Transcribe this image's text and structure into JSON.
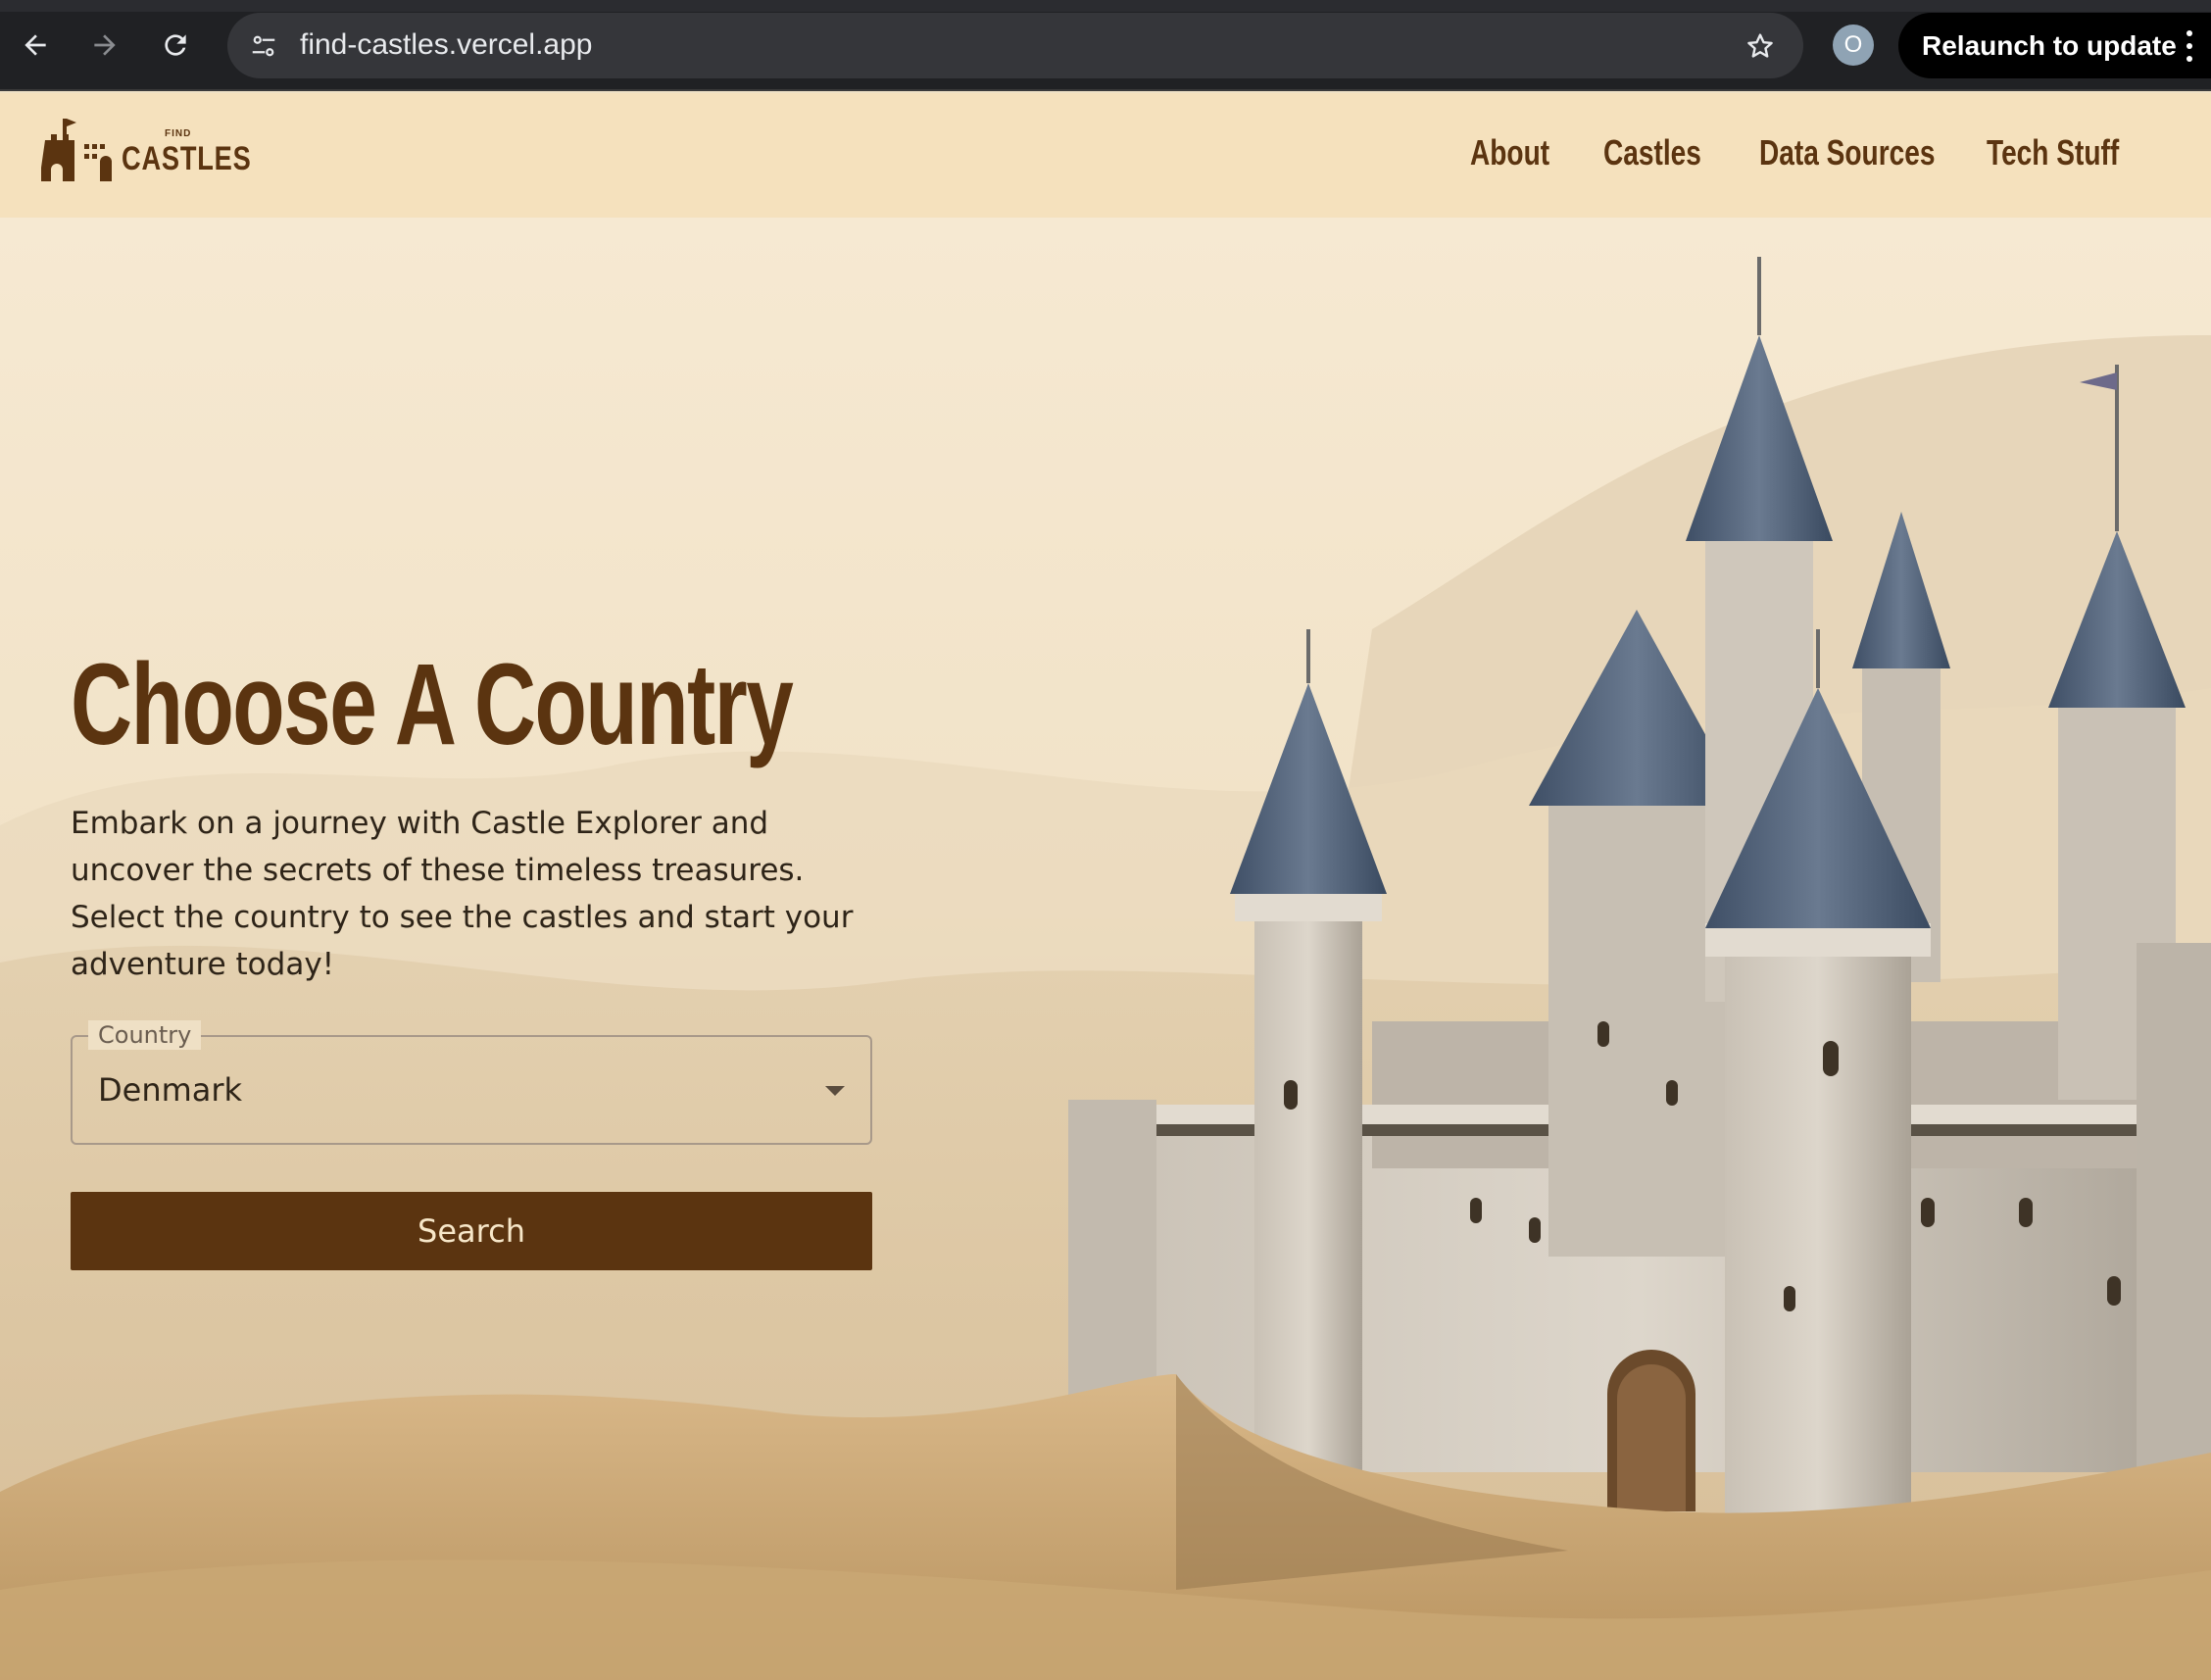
{
  "browser": {
    "url": "find-castles.vercel.app",
    "profile_initial": "O",
    "relaunch_label": "Relaunch to update",
    "icons": [
      "back-arrow-icon",
      "forward-arrow-icon",
      "reload-icon",
      "site-settings-icon",
      "bookmark-star-icon",
      "more-menu-icon"
    ]
  },
  "header": {
    "logo_small": "FIND",
    "logo_main": "CASTLES",
    "nav": [
      "About",
      "Castles",
      "Data Sources",
      "Tech Stuff"
    ]
  },
  "hero": {
    "title": "Choose A Country",
    "description": "Embark on a journey with Castle Explorer and uncover the secrets of these timeless treasures. Select the country to see the castles and start your adventure today!",
    "country_label": "Country",
    "country_value": "Denmark",
    "search_label": "Search"
  },
  "colors": {
    "brand_brown": "#5b3410",
    "header_bg": "#f5e1bd",
    "hero_bg": "#f1e2c7",
    "button_text": "#f7e7c9",
    "browser_chrome": "#202124"
  }
}
